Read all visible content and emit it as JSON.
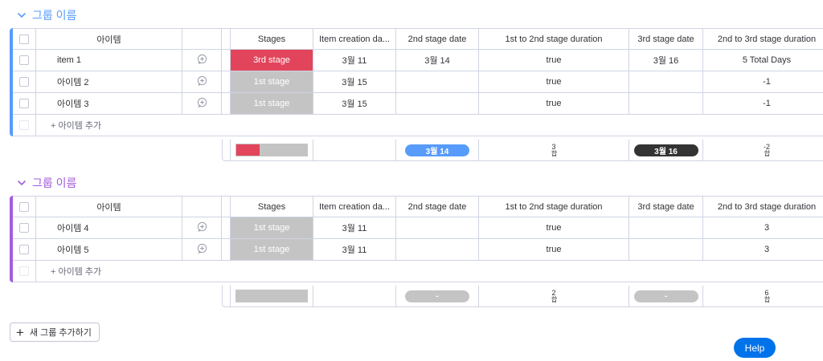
{
  "groups": [
    {
      "title": "그룹 이름",
      "color": "#579bfc",
      "columns": {
        "item": "아이템",
        "stages": "Stages",
        "creation": "Item creation da...",
        "d2": "2nd stage date",
        "dur1": "1st to 2nd stage duration",
        "d3": "3rd stage date",
        "dur2": "2nd to 3rd stage duration"
      },
      "rows": [
        {
          "name": "item 1",
          "stage": "3rd stage",
          "stage_color": "#e2445c",
          "creation": "3월 11",
          "d2": "3월 14",
          "dur1": "true",
          "d3": "3월 16",
          "dur2": "5 Total Days"
        },
        {
          "name": "아이템 2",
          "stage": "1st stage",
          "stage_color": "#c4c4c4",
          "creation": "3월 15",
          "d2": "",
          "dur1": "true",
          "d3": "",
          "dur2": "-1"
        },
        {
          "name": "아이템 3",
          "stage": "1st stage",
          "stage_color": "#c4c4c4",
          "creation": "3월 15",
          "d2": "",
          "dur1": "true",
          "d3": "",
          "dur2": "-1"
        }
      ],
      "add_item": "+ 아이템 추가",
      "summary": {
        "stage_progress": [
          {
            "color": "#e2445c",
            "fraction": 0.333
          },
          {
            "color": "#c4c4c4",
            "fraction": 0.667
          }
        ],
        "d2_pill": "3월 14",
        "d2_pill_color": "#579bfc",
        "dur1_num": "3",
        "dur1_unit": "합",
        "d3_pill": "3월 16",
        "d3_pill_color": "#333333",
        "dur2_num": "-2",
        "dur2_unit": "합"
      }
    },
    {
      "title": "그룹 이름",
      "color": "#a25ddc",
      "columns": {
        "item": "아이템",
        "stages": "Stages",
        "creation": "Item creation da...",
        "d2": "2nd stage date",
        "dur1": "1st to 2nd stage duration",
        "d3": "3rd stage date",
        "dur2": "2nd to 3rd stage duration"
      },
      "rows": [
        {
          "name": "아이템 4",
          "stage": "1st stage",
          "stage_color": "#c4c4c4",
          "creation": "3월 11",
          "d2": "",
          "dur1": "true",
          "d3": "",
          "dur2": "3"
        },
        {
          "name": "아이템 5",
          "stage": "1st stage",
          "stage_color": "#c4c4c4",
          "creation": "3월 11",
          "d2": "",
          "dur1": "true",
          "d3": "",
          "dur2": "3"
        }
      ],
      "add_item": "+ 아이템 추가",
      "summary": {
        "stage_progress": [
          {
            "color": "#c4c4c4",
            "fraction": 1.0
          }
        ],
        "d2_pill": "-",
        "d2_pill_color": "#c4c4c4",
        "dur1_num": "2",
        "dur1_unit": "합",
        "d3_pill": "-",
        "d3_pill_color": "#c4c4c4",
        "dur2_num": "6",
        "dur2_unit": "합"
      }
    }
  ],
  "new_group_button": "새 그룹 추가하기",
  "help_button": "Help",
  "icons": {
    "group_toggle": "chevron-down-icon",
    "add_update": "add-update-icon",
    "new_group": "plus-icon"
  }
}
